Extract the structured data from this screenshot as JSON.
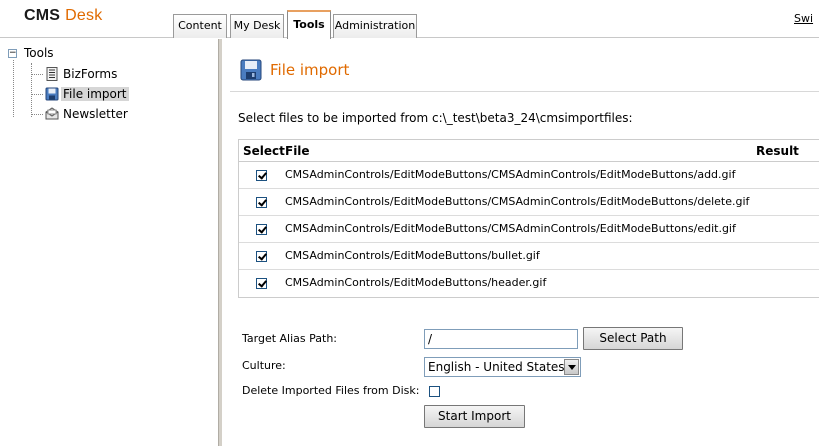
{
  "header": {
    "logo_main": "CMS",
    "logo_accent": "Desk",
    "tabs": [
      {
        "label": "Content"
      },
      {
        "label": "My Desk"
      },
      {
        "label": "Tools"
      },
      {
        "label": "Administration"
      }
    ],
    "switch_label": "Swi"
  },
  "tree": {
    "root": "Tools",
    "items": [
      {
        "label": "BizForms",
        "icon": "form-icon"
      },
      {
        "label": "File import",
        "icon": "file-import-icon",
        "selected": true
      },
      {
        "label": "Newsletter",
        "icon": "newsletter-icon"
      }
    ]
  },
  "main": {
    "title": "File import",
    "instructions": "Select files to be imported from c:\\_test\\beta3_24\\cmsimportfiles:",
    "table": {
      "headers": {
        "select": "Select",
        "file": "File",
        "result": "Result"
      },
      "rows": [
        {
          "file": "CMSAdminControls/EditModeButtons/CMSAdminControls/EditModeButtons/add.gif",
          "checked": true
        },
        {
          "file": "CMSAdminControls/EditModeButtons/CMSAdminControls/EditModeButtons/delete.gif",
          "checked": true
        },
        {
          "file": "CMSAdminControls/EditModeButtons/CMSAdminControls/EditModeButtons/edit.gif",
          "checked": true
        },
        {
          "file": "CMSAdminControls/EditModeButtons/bullet.gif",
          "checked": true
        },
        {
          "file": "CMSAdminControls/EditModeButtons/header.gif",
          "checked": true
        }
      ]
    },
    "form": {
      "alias_label": "Target Alias Path:",
      "alias_value": "/",
      "select_path_label": "Select Path",
      "culture_label": "Culture:",
      "culture_value": "English - United States",
      "delete_label": "Delete Imported Files from Disk:",
      "delete_checked": false,
      "start_import_label": "Start Import"
    }
  },
  "colors": {
    "accent": "#e06a00",
    "tab_border": "#9a9a9a",
    "splitter": "#d4d0c8"
  }
}
